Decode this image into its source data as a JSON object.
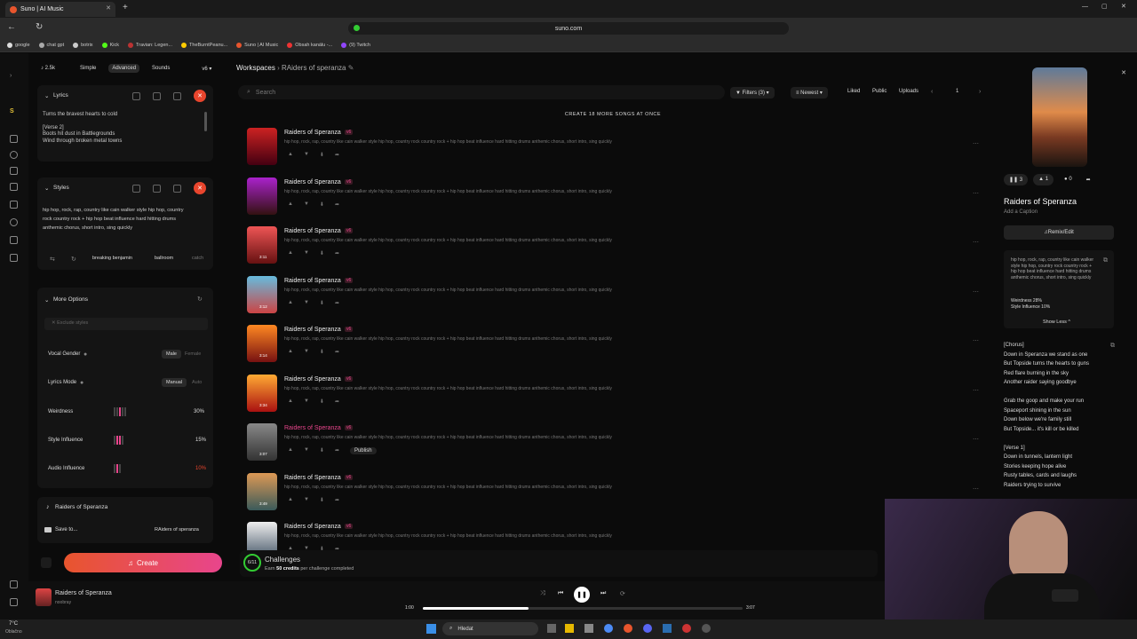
{
  "browser": {
    "tab_title": "Suno | AI Music",
    "url": "suno.com",
    "bookmarks": [
      "google",
      "chat gpt",
      "botrix",
      "Kick",
      "Travian: Legen...",
      "TheBurntPeanu...",
      "Suno | AI Music",
      "Obsah kanálu -...",
      "(9) Twitch"
    ]
  },
  "left_panel": {
    "credits": "2.5k",
    "tabs": [
      "Simple",
      "Advanced",
      "Sounds"
    ],
    "version": "v6",
    "lyrics_title": "Lyrics",
    "lyrics_lines": [
      "Turns the bravest hearts to cold",
      "",
      "[Verse 2]",
      "Boots hit dust in Battlegrounds",
      "Wind through broken metal towns"
    ],
    "styles_title": "Styles",
    "styles_text": "hip hop, rock, rap, country like cain walker style hip hop, country rock country rock + hip hop beat influence hard hitting drums anthemic chorus, short intro, sing quickly",
    "style_tags": [
      "breaking benjamin",
      "ballroom",
      "catch"
    ],
    "more_options": "More Options",
    "exclude_placeholder": "Exclude styles",
    "vocal_gender": {
      "label": "Vocal Gender",
      "opt1": "Male",
      "opt2": "Female"
    },
    "lyrics_mode": {
      "label": "Lyrics Mode",
      "opt1": "Manual",
      "opt2": "Auto"
    },
    "weirdness": {
      "label": "Weirdness",
      "value": "30%"
    },
    "style_influence": {
      "label": "Style Influence",
      "value": "15%"
    },
    "audio_influence": {
      "label": "Audio Influence",
      "value": "10%"
    },
    "song_name": "Raiders of Speranza",
    "save_to": "Save to...",
    "save_target": "RAiders of speranza",
    "create_label": "Create"
  },
  "main": {
    "breadcrumb_root": "Workspaces",
    "breadcrumb_current": "RAiders of speranza",
    "search_placeholder": "Search",
    "filters": "Filters (3)",
    "sort": "Newest",
    "liked": "Liked",
    "public": "Public",
    "uploads": "Uploads",
    "page": "1",
    "banner": "CREATE 18 MORE SONGS AT ONCE",
    "song_desc": "hip hop, rock, rap, country like cain walker style hip hop, country rock country rock + hip hop beat influence hard hitting drums anthemic chorus, short intro, sing quickly",
    "version_badge": "v6",
    "publish": "Publish",
    "songs": [
      {
        "title": "Raiders of Speranza",
        "duration": ""
      },
      {
        "title": "Raiders of Speranza",
        "duration": ""
      },
      {
        "title": "Raiders of Speranza",
        "duration": "3:11"
      },
      {
        "title": "Raiders of Speranza",
        "duration": "3:12"
      },
      {
        "title": "Raiders of Speranza",
        "duration": "3:14"
      },
      {
        "title": "Raiders of Speranza",
        "duration": "3:34"
      },
      {
        "title": "Raiders of Speranza",
        "duration": "3:07"
      },
      {
        "title": "Raiders of Speranza",
        "duration": "3:49"
      },
      {
        "title": "Raiders of Speranza",
        "duration": ""
      }
    ],
    "challenges_progress": "6/11",
    "challenges_title": "Challenges",
    "challenges_sub_bold": "50 credits",
    "challenges_sub_pre": "Earn",
    "challenges_sub_post": "per challenge completed"
  },
  "right_panel": {
    "plays": "3",
    "likes": "1",
    "comments": "0",
    "title": "Raiders of Speranza",
    "caption": "Add a Caption",
    "remix": "Remix/Edit",
    "style_text": "hip hop, rock, rap, country like cain walker style hip hop, country rock country rock + hip hop beat influence hard hitting drums anthemic chorus, short intro, sing quickly",
    "weirdness": "Weirdness 28%",
    "style_influence": "Style Influence 10%",
    "show_less": "Show Less",
    "lyrics": [
      "[Chorus]",
      "Down in Speranza we stand as one",
      "But Topside turns the hearts to guns",
      "Red flare burning in the sky",
      "Another raider saying goodbye",
      "",
      "Grab the goop and make your run",
      "Spaceport shining in the sun",
      "Down below we're family still",
      "But Topside... it's kill or be killed",
      "",
      "[Verse 1]",
      "Down in tunnels, lantern light",
      "Stories keeping hope alive",
      "Rusty tables, cards and laughs",
      "Raiders trying to survive"
    ]
  },
  "player": {
    "title": "Raiders of Speranza",
    "artist": "noobray",
    "current": "1:00",
    "total": "3:07",
    "progress": 0.33
  },
  "taskbar": {
    "weather_temp": "7°C",
    "weather_desc": "Oblačno",
    "search": "Hledat"
  }
}
